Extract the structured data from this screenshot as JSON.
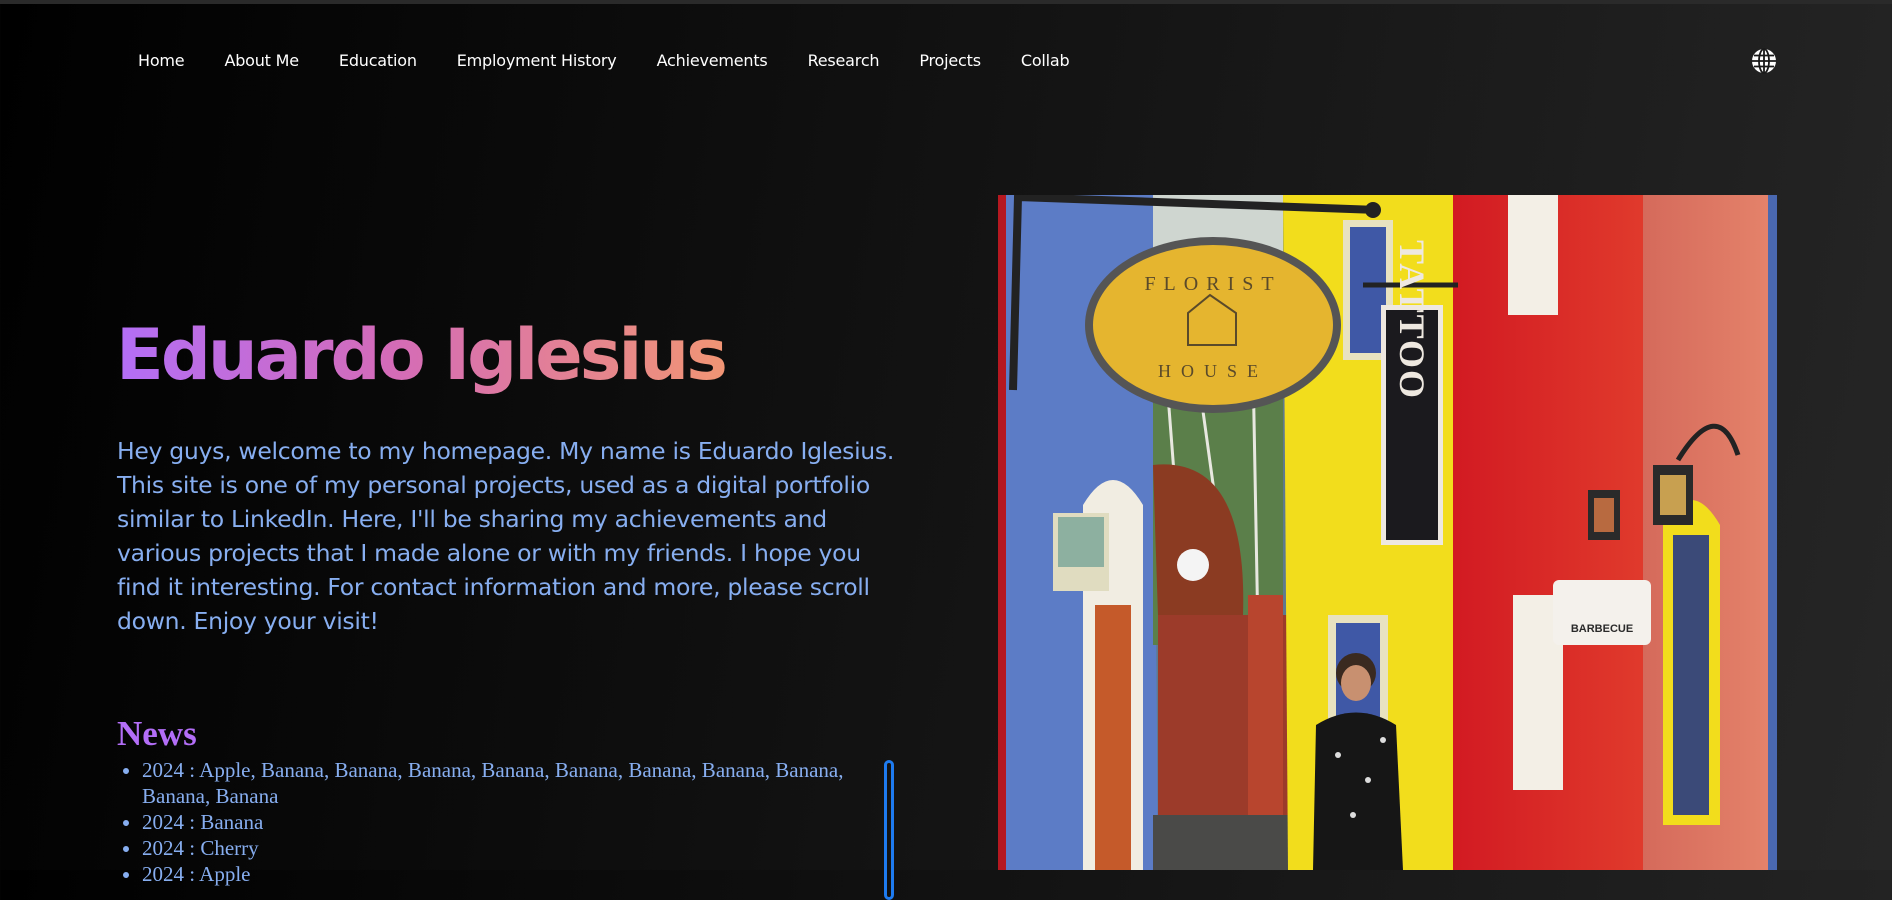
{
  "nav": {
    "items": [
      {
        "label": "Home"
      },
      {
        "label": "About Me"
      },
      {
        "label": "Education"
      },
      {
        "label": "Employment History"
      },
      {
        "label": "Achievements"
      },
      {
        "label": "Research"
      },
      {
        "label": "Projects"
      },
      {
        "label": "Collab"
      }
    ],
    "language_icon": "globe-icon"
  },
  "hero": {
    "title": "Eduardo Iglesius",
    "intro": "Hey guys, welcome to my homepage. My name is Eduardo Iglesius. This site is one of my personal projects, used as a digital portfolio similar to LinkedIn. Here, I'll be sharing my achievements and various projects that I made alone or with my friends. I hope you find it interesting. For contact information and more, please scroll down. Enjoy your visit!"
  },
  "news": {
    "title": "News",
    "items": [
      "2024 : Apple, Banana, Banana, Banana, Banana, Banana, Banana, Banana, Banana, Banana, Banana",
      "2024 : Banana",
      "2024 : Cherry",
      "2024 : Apple"
    ]
  },
  "photo": {
    "sign_top": "FLORIST",
    "sign_bottom": "HOUSE",
    "tattoo_text": "TATTOO",
    "bbq_text": "BARBECUE"
  },
  "colors": {
    "title_gradient_start": "#b36ef7",
    "title_gradient_end": "#f19574",
    "intro_text": "#87aef0",
    "news_title": "#b36ef7",
    "scrollbar": "#1e7bf0"
  }
}
